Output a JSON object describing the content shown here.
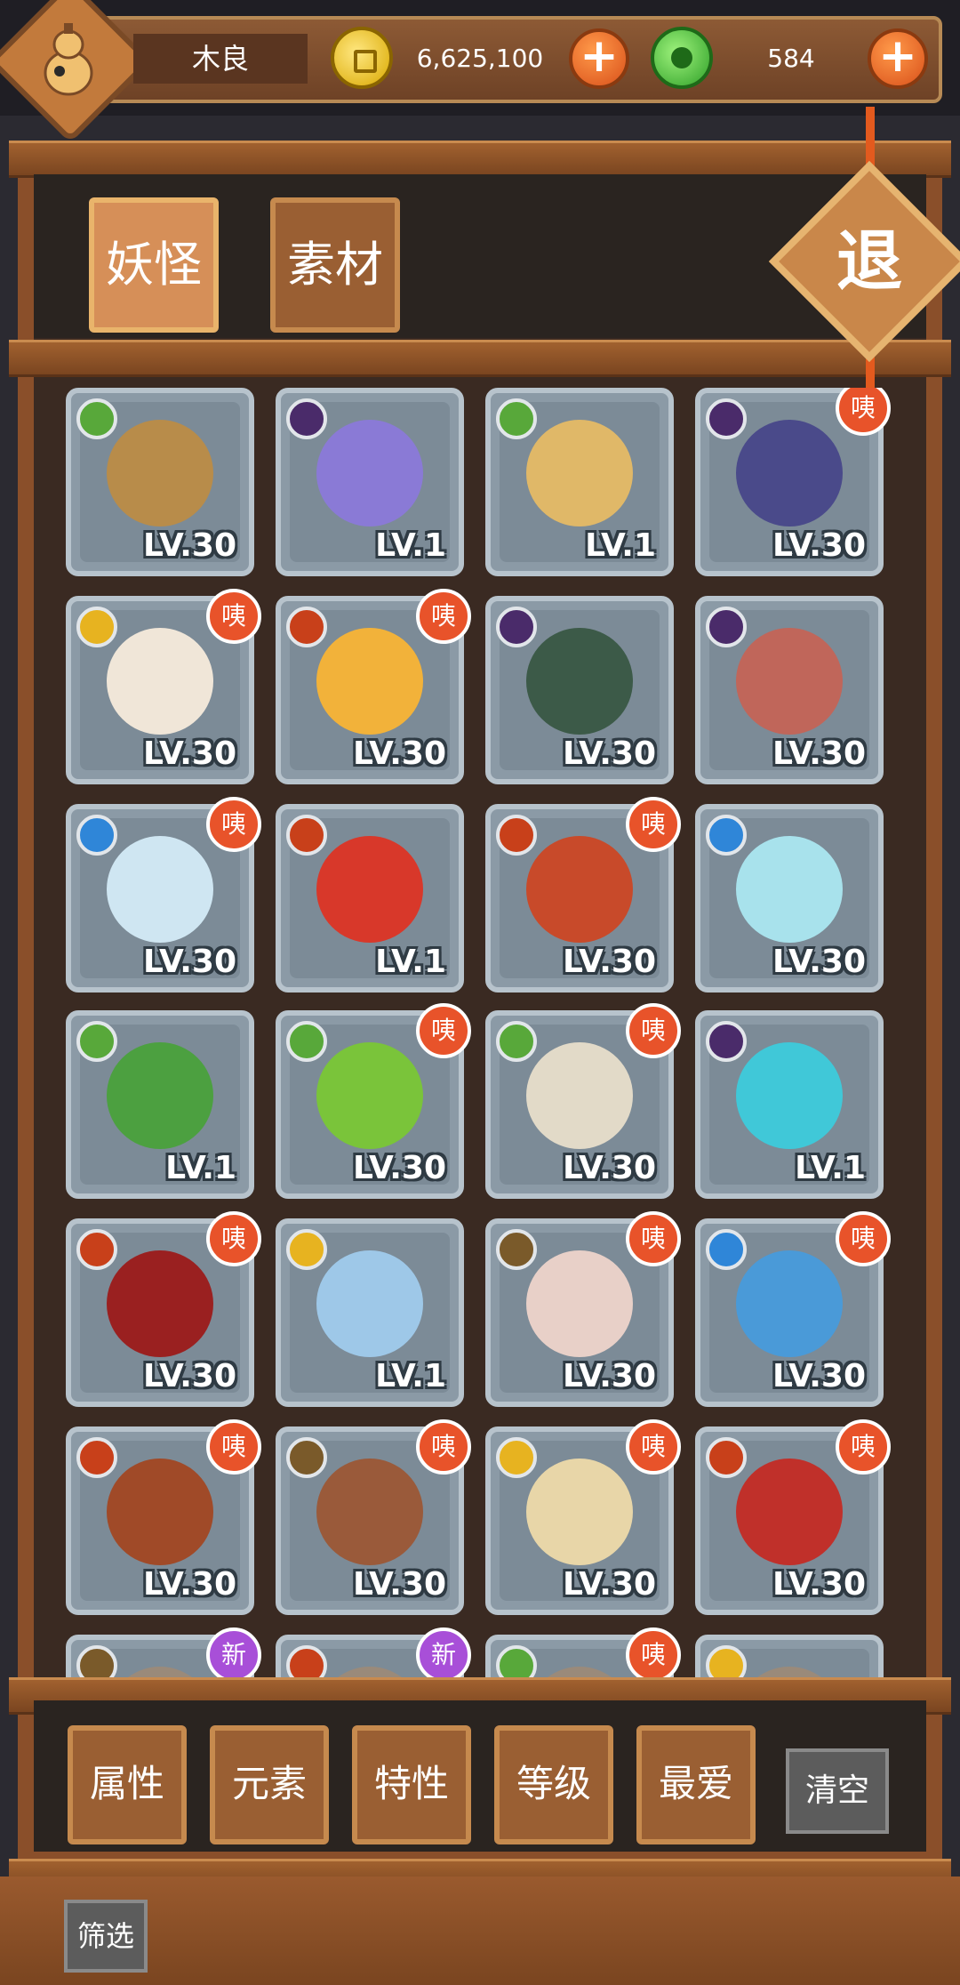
{
  "player": {
    "name": "木良"
  },
  "currency": {
    "gold": "6,625,100",
    "jade": "584"
  },
  "tabs": [
    {
      "label": "妖怪",
      "active": true
    },
    {
      "label": "素材",
      "active": false
    }
  ],
  "exit_label": "退",
  "cards": [
    {
      "element": "leaf",
      "level": "LV.30",
      "tag": "",
      "color": "#b88c4a"
    },
    {
      "element": "dark",
      "level": "LV.1",
      "tag": "",
      "color": "#8a7ad6"
    },
    {
      "element": "leaf",
      "level": "LV.1",
      "tag": "",
      "color": "#e0b868"
    },
    {
      "element": "dark",
      "level": "LV.30",
      "tag": "咦",
      "color": "#4a4a8a"
    },
    {
      "element": "sun",
      "level": "LV.30",
      "tag": "咦",
      "color": "#f0e6d8"
    },
    {
      "element": "fire",
      "level": "LV.30",
      "tag": "咦",
      "color": "#f2b23a"
    },
    {
      "element": "dark",
      "level": "LV.30",
      "tag": "",
      "color": "#3c5a48"
    },
    {
      "element": "dark",
      "level": "LV.30",
      "tag": "",
      "color": "#c0665a"
    },
    {
      "element": "water",
      "level": "LV.30",
      "tag": "咦",
      "color": "#cfe6f2"
    },
    {
      "element": "fire",
      "level": "LV.1",
      "tag": "",
      "color": "#d8382a"
    },
    {
      "element": "fire",
      "level": "LV.30",
      "tag": "咦",
      "color": "#c84a2a"
    },
    {
      "element": "water",
      "level": "LV.30",
      "tag": "",
      "color": "#a8e2ec"
    },
    {
      "element": "leaf",
      "level": "LV.1",
      "tag": "",
      "color": "#4ca040"
    },
    {
      "element": "leaf",
      "level": "LV.30",
      "tag": "咦",
      "color": "#7ac43a"
    },
    {
      "element": "leaf",
      "level": "LV.30",
      "tag": "咦",
      "color": "#e2dac8"
    },
    {
      "element": "dark",
      "level": "LV.1",
      "tag": "",
      "color": "#40c8d8"
    },
    {
      "element": "fire",
      "level": "LV.30",
      "tag": "咦",
      "color": "#9a2020"
    },
    {
      "element": "sun",
      "level": "LV.1",
      "tag": "",
      "color": "#9ec8e8"
    },
    {
      "element": "earth",
      "level": "LV.30",
      "tag": "咦",
      "color": "#e8d0c8"
    },
    {
      "element": "water",
      "level": "LV.30",
      "tag": "咦",
      "color": "#4a9ad8"
    },
    {
      "element": "fire",
      "level": "LV.30",
      "tag": "咦",
      "color": "#a04a28"
    },
    {
      "element": "earth",
      "level": "LV.30",
      "tag": "咦",
      "color": "#9a5a3a"
    },
    {
      "element": "sun",
      "level": "LV.30",
      "tag": "咦",
      "color": "#e8d6a8"
    },
    {
      "element": "fire",
      "level": "LV.30",
      "tag": "咦",
      "color": "#c0302a"
    },
    {
      "element": "earth",
      "level": "",
      "tag": "新",
      "color": "#9a8a7a"
    },
    {
      "element": "fire",
      "level": "",
      "tag": "新",
      "color": "#9a8a7a"
    },
    {
      "element": "leaf",
      "level": "",
      "tag": "咦",
      "color": "#9a8a7a"
    },
    {
      "element": "sun",
      "level": "",
      "tag": "",
      "color": "#9a8a7a"
    }
  ],
  "filters": [
    "属性",
    "元素",
    "特性",
    "等级",
    "最爱"
  ],
  "clear_label": "清空",
  "screen_label": "筛选"
}
